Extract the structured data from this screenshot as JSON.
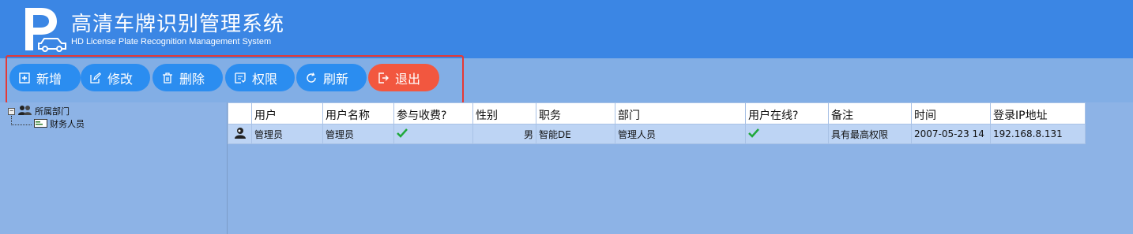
{
  "app": {
    "logo_letter": "P",
    "title_cn": "高清车牌识别管理系统",
    "title_en": "HD License Plate Recognition Management System"
  },
  "toolbar": {
    "add": "新增",
    "edit": "修改",
    "delete": "删除",
    "permissions": "权限",
    "refresh": "刷新",
    "exit": "退出"
  },
  "tree": {
    "root": "所属部门",
    "child": "财务人员"
  },
  "table": {
    "columns": [
      "用户",
      "用户名称",
      "参与收费?",
      "性别",
      "职务",
      "部门",
      "用户在线?",
      "备注",
      "时间",
      "登录IP地址"
    ],
    "rows": [
      {
        "user": "管理员",
        "username": "管理员",
        "charge": true,
        "gender": "男",
        "position": "智能DE",
        "department": "管理人员",
        "online": true,
        "remark": "具有最高权限",
        "time": "2007-05-23 14",
        "ip": "192.168.8.131"
      }
    ]
  },
  "colors": {
    "header_bg": "#3b86e4",
    "button_bg": "#2b8df0",
    "exit_bg": "#f2573f",
    "highlight": "#e53935",
    "check": "#1fa83a"
  }
}
